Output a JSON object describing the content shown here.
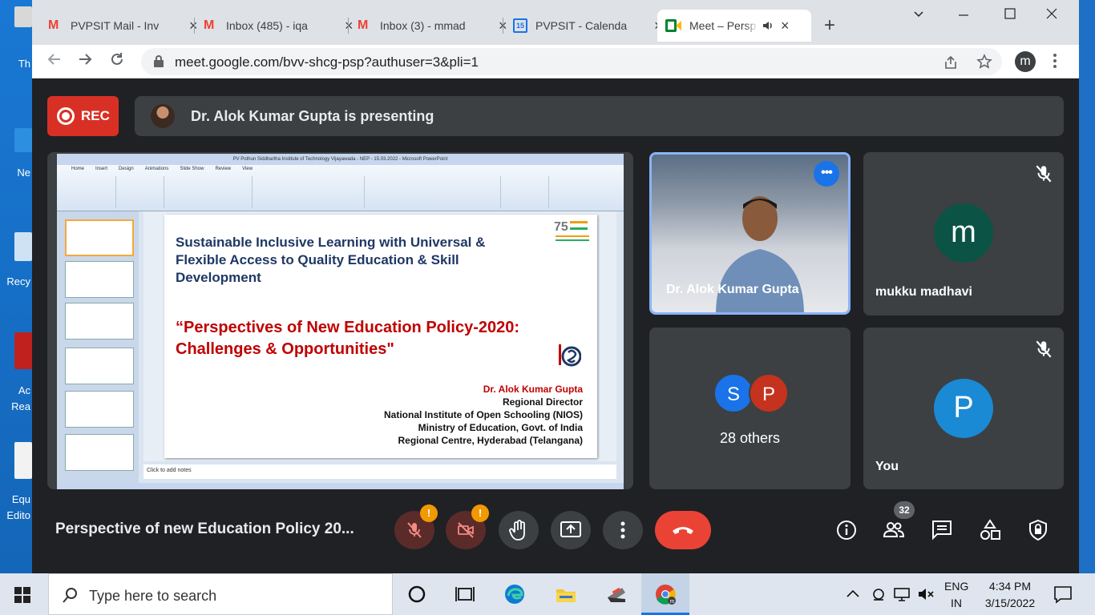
{
  "desktop": {
    "labels": [
      "Th",
      "Ne",
      "Recy",
      "Ac",
      "Rea",
      "Equ",
      "Edito"
    ]
  },
  "tabs": [
    {
      "title": "PVPSIT Mail - Inv"
    },
    {
      "title": "Inbox (485) - iqa"
    },
    {
      "title": "Inbox (3) - mmad"
    },
    {
      "title": "PVPSIT - Calenda"
    },
    {
      "title": "Meet – Persp"
    }
  ],
  "calendar_icon_text": "15",
  "address_bar": {
    "url": "meet.google.com/bvv-shcg-psp?authuser=3&pli=1"
  },
  "profile_initial": "m",
  "rec": {
    "label": "REC"
  },
  "presenting": {
    "text": "Dr. Alok Kumar Gupta is presenting"
  },
  "ppt": {
    "window_title": "PV Pothun Siddhartha Institute of Technology Vijayawada - NEP - 15.03.2022 - Microsoft PowerPoint",
    "ribbon_tabs": [
      "Home",
      "Insert",
      "Design",
      "Animations",
      "Slide Show",
      "Review",
      "View"
    ],
    "notes_placeholder": "Click to add notes",
    "slide": {
      "subtitle": "Sustainable Inclusive Learning with Universal & Flexible Access to Quality Education & Skill Development",
      "title": "“Perspectives of New Education Policy-2020: Challenges & Opportunities\"",
      "author_name": "Dr. Alok Kumar Gupta",
      "author_lines": [
        "Regional Director",
        "National Institute of Open Schooling (NIOS)",
        "Ministry of Education, Govt. of India",
        "Regional Centre, Hyderabad (Telangana)"
      ],
      "logo_text": "75 Azadi Ka Amrit Mahotsav"
    }
  },
  "participants": {
    "speaker": {
      "name": "Dr. Alok Kumar Gupta"
    },
    "mukku": {
      "name": "mukku madhavi",
      "initial": "m",
      "color": "#0b5345"
    },
    "others": {
      "label": "28 others",
      "initials": [
        "S",
        "P"
      ],
      "colors": [
        "#1a73e8",
        "#c5321d"
      ]
    },
    "you": {
      "name": "You",
      "initial": "P",
      "color": "#1a8ad4"
    }
  },
  "meeting": {
    "title": "Perspective of new Education Policy 20...",
    "participant_count": "32"
  },
  "warn_mark": "!",
  "taskbar": {
    "search_placeholder": "Type here to search",
    "lang_top": "ENG",
    "lang_bottom": "IN",
    "time": "4:34 PM",
    "date": "3/15/2022"
  },
  "colors": {
    "rec": "#d93025",
    "end_call": "#ea4335",
    "accent": "#1a73e8",
    "active_border": "#8ab4f8"
  }
}
